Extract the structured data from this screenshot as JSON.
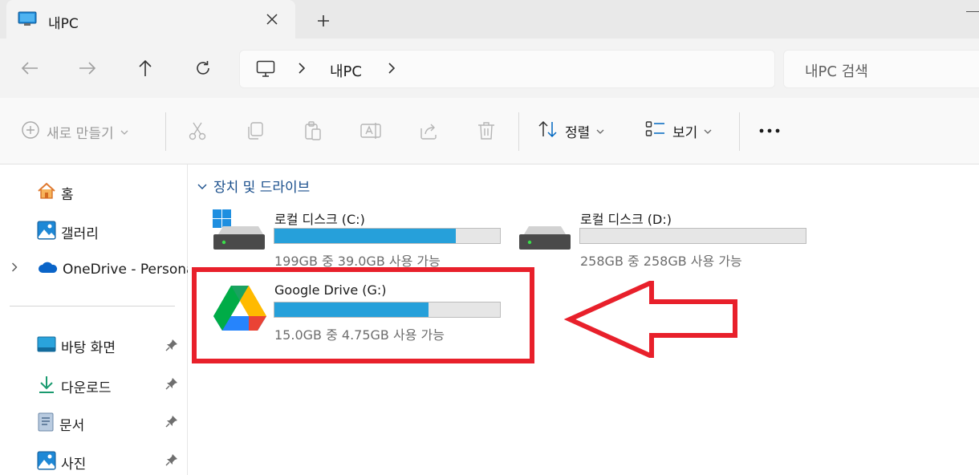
{
  "window": {
    "tab_title": "내PC",
    "tab_icon": "pc-monitor-icon",
    "close_icon": "close-icon",
    "new_tab_icon": "plus-icon"
  },
  "nav": {
    "back_icon": "arrow-left-icon",
    "forward_icon": "arrow-right-icon",
    "up_icon": "arrow-up-icon",
    "refresh_icon": "refresh-icon",
    "address": {
      "icon": "pc-monitor-icon",
      "location": "내PC"
    },
    "search_placeholder": "내PC 검색"
  },
  "toolbar": {
    "new_label": "새로 만들기",
    "actions": [
      "cut-icon",
      "copy-icon",
      "paste-icon",
      "rename-icon",
      "share-icon",
      "delete-icon"
    ],
    "sort_label": "정렬",
    "view_label": "보기",
    "more_icon": "more-horizontal-icon"
  },
  "sidebar": {
    "items": [
      {
        "label": "홈",
        "icon": "home-icon"
      },
      {
        "label": "갤러리",
        "icon": "gallery-icon"
      },
      {
        "label": "OneDrive - Persona",
        "icon": "cloud-icon"
      },
      {
        "label": "바탕 화면",
        "icon": "desktop-icon",
        "pinned": true
      },
      {
        "label": "다운로드",
        "icon": "download-icon",
        "pinned": true
      },
      {
        "label": "문서",
        "icon": "document-icon",
        "pinned": true
      },
      {
        "label": "사진",
        "icon": "pictures-icon",
        "pinned": true
      }
    ]
  },
  "content": {
    "group_title": "장치 및 드라이브",
    "drives": [
      {
        "name": "로컬 디스크 (C:)",
        "detail": "199GB 중 39.0GB 사용 가능",
        "used_fraction": 0.804,
        "icon": "windows-drive-icon"
      },
      {
        "name": "로컬 디스크 (D:)",
        "detail": "258GB 중 258GB 사용 가능",
        "used_fraction": 0.0,
        "icon": "drive-icon"
      },
      {
        "name": "Google Drive (G:)",
        "detail": "15.0GB 중 4.75GB 사용 가능",
        "used_fraction": 0.683,
        "icon": "google-drive-icon"
      }
    ]
  },
  "colors": {
    "usage_bar": "#26a0da",
    "annotation": "#e8202b",
    "accent": "#0067c0"
  }
}
